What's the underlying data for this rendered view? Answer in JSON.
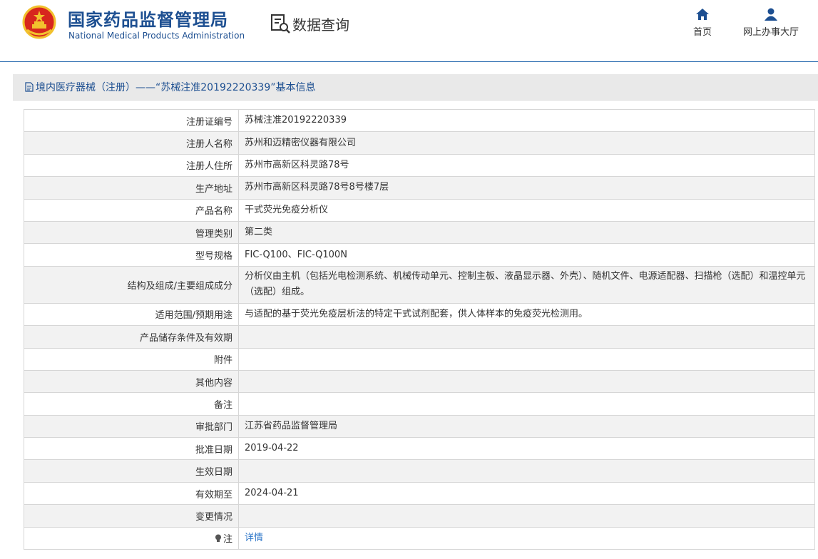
{
  "header": {
    "agency_cn": "国家药品监督管理局",
    "agency_en": "National Medical Products Administration",
    "query_title": "数据查询",
    "nav": {
      "home": "首页",
      "online_hall": "网上办事大厅"
    }
  },
  "section": {
    "title": "境内医疗器械（注册）——“苏械注准20192220339”基本信息"
  },
  "rows": [
    {
      "label": "注册证编号",
      "value": "苏械注准20192220339"
    },
    {
      "label": "注册人名称",
      "value": "苏州和迈精密仪器有限公司"
    },
    {
      "label": "注册人住所",
      "value": "苏州市高新区科灵路78号"
    },
    {
      "label": "生产地址",
      "value": "苏州市高新区科灵路78号8号楼7层"
    },
    {
      "label": "产品名称",
      "value": "干式荧光免疫分析仪"
    },
    {
      "label": "管理类别",
      "value": "第二类"
    },
    {
      "label": "型号规格",
      "value": "FIC-Q100、FIC-Q100N"
    },
    {
      "label": "结构及组成/主要组成成分",
      "value": "分析仪由主机（包括光电检测系统、机械传动单元、控制主板、液晶显示器、外壳）、随机文件、电源适配器、扫描枪（选配）和温控单元（选配）组成。"
    },
    {
      "label": "适用范围/预期用途",
      "value": "与适配的基于荧光免疫层析法的特定干式试剂配套，供人体样本的免疫荧光检测用。"
    },
    {
      "label": "产品储存条件及有效期",
      "value": ""
    },
    {
      "label": "附件",
      "value": ""
    },
    {
      "label": "其他内容",
      "value": ""
    },
    {
      "label": "备注",
      "value": ""
    },
    {
      "label": "审批部门",
      "value": "江苏省药品监督管理局"
    },
    {
      "label": "批准日期",
      "value": "2019-04-22"
    },
    {
      "label": "生效日期",
      "value": ""
    },
    {
      "label": "有效期至",
      "value": "2024-04-21"
    },
    {
      "label": "变更情况",
      "value": ""
    },
    {
      "label": "注",
      "value": "详情"
    }
  ],
  "colors": {
    "brand_blue": "#1d4f91",
    "link_blue": "#2e77c9",
    "emblem_red": "#d7261e",
    "emblem_gold": "#f2c12e"
  },
  "icons": {
    "emblem": "national-emblem",
    "query": "document-search-icon",
    "home": "home-icon",
    "hall": "user-icon",
    "section": "document-icon",
    "note": "lightbulb-icon"
  }
}
